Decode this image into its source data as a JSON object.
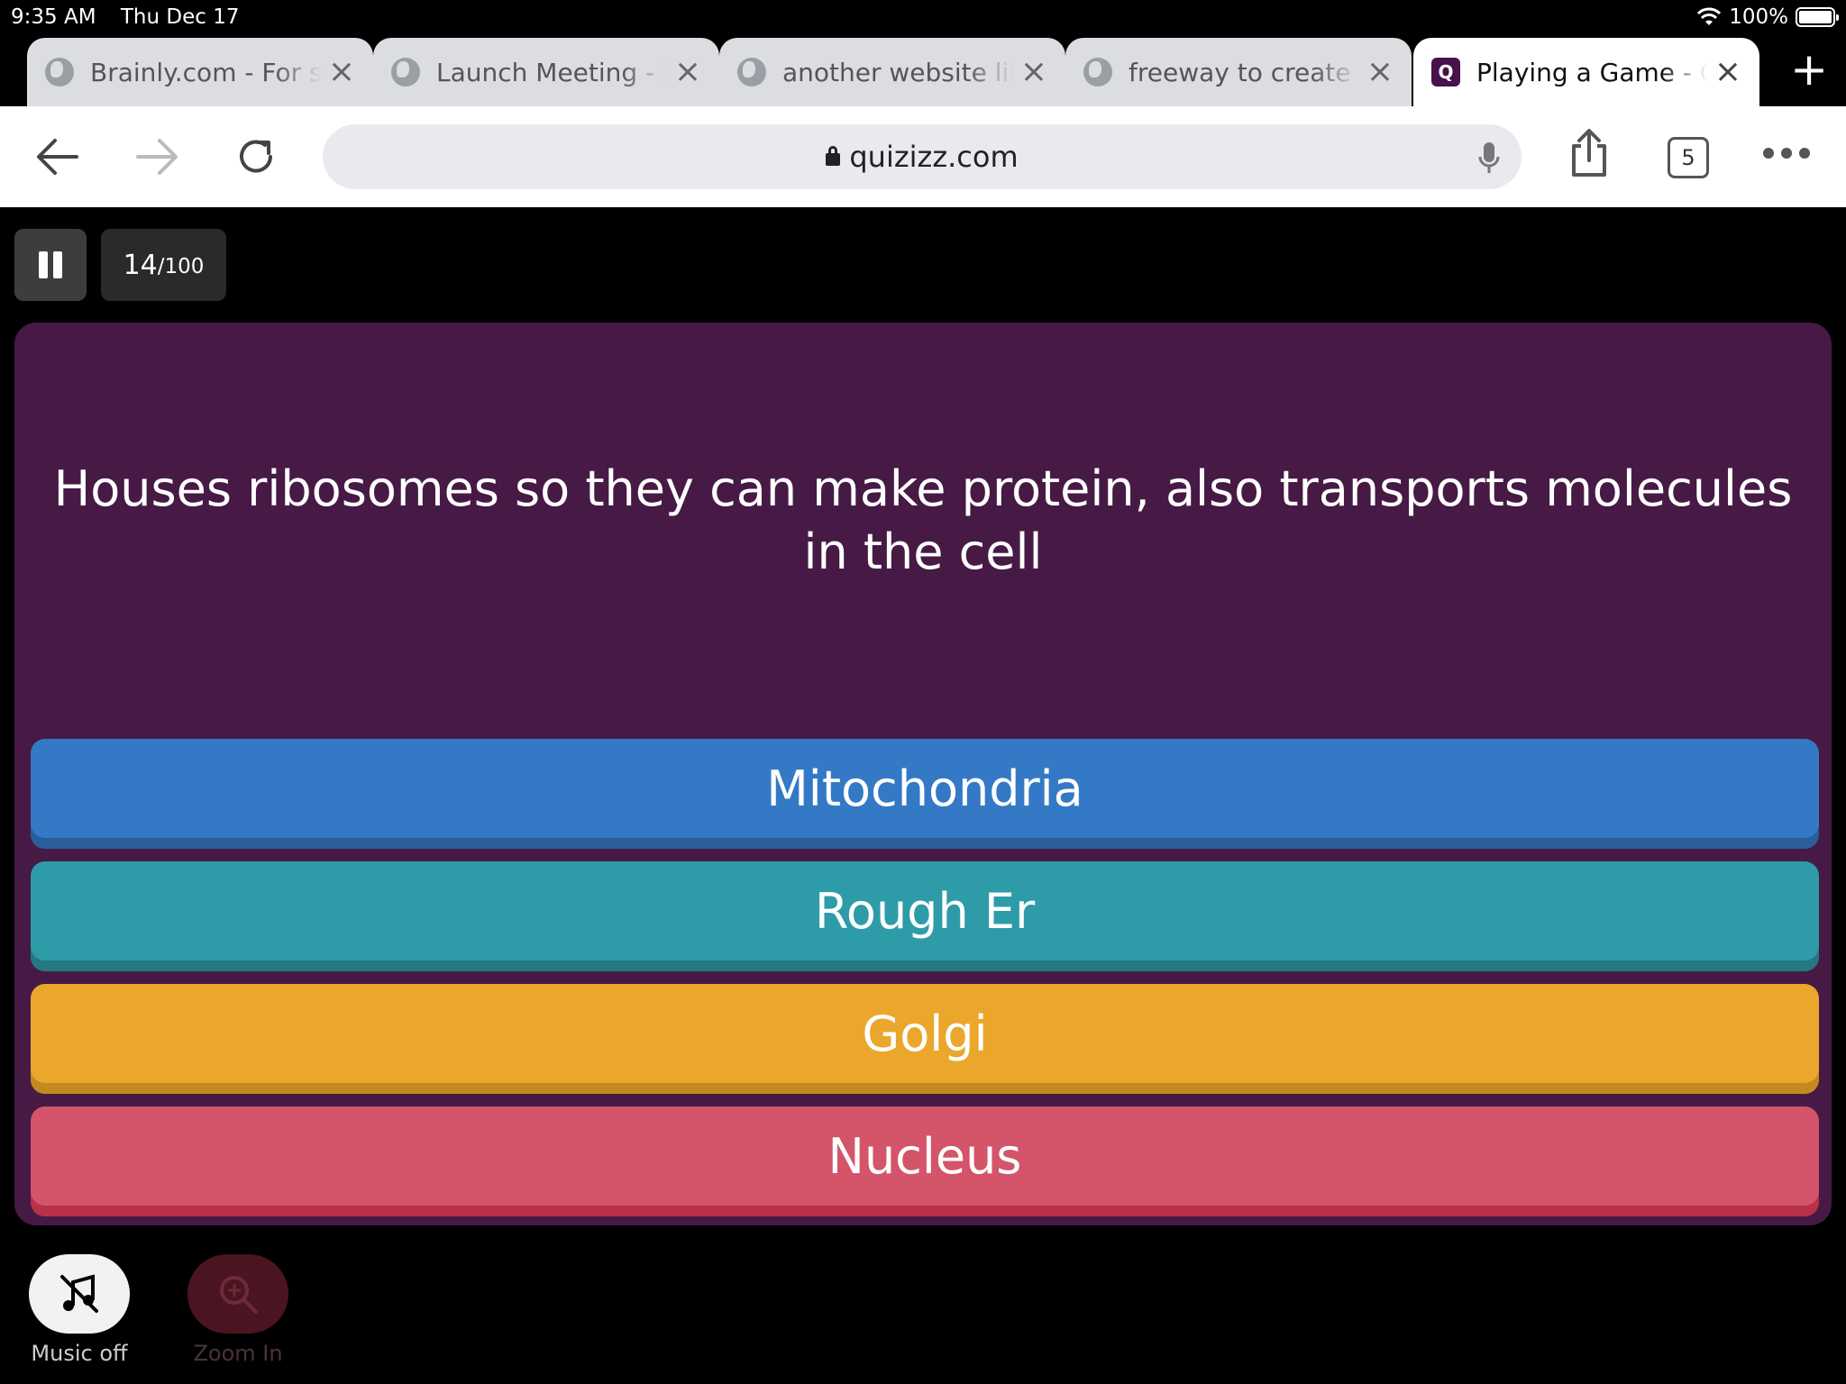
{
  "status": {
    "time": "9:35 AM",
    "date": "Thu Dec 17",
    "battery": "100%"
  },
  "tabs": [
    {
      "title": "Brainly.com - For s"
    },
    {
      "title": "Launch Meeting - Z"
    },
    {
      "title": "another website lik"
    },
    {
      "title": "freeway to create a"
    },
    {
      "title": "Playing a Game - Q",
      "active": true
    }
  ],
  "toolbar": {
    "url": "quizizz.com",
    "tab_count": "5"
  },
  "game": {
    "current": "14",
    "total": "/100",
    "question": "Houses ribosomes so they can make protein, also transports molecules in the cell",
    "options": [
      "Mitochondria",
      "Rough Er",
      "Golgi",
      "Nucleus"
    ]
  },
  "bottom": {
    "music_label": "Music off",
    "zoom_label": "Zoom In"
  },
  "colors": {
    "panel": "#461a45",
    "option1": "#3479c6",
    "option2": "#2d9ca8",
    "option3": "#eba72c",
    "option4": "#d4546a"
  },
  "icons": [
    "wifi-icon",
    "battery-icon",
    "globe-icon",
    "close-icon",
    "plus-icon",
    "back-arrow-icon",
    "forward-arrow-icon",
    "reload-icon",
    "lock-icon",
    "microphone-icon",
    "share-icon",
    "tabs-icon",
    "more-icon",
    "pause-icon",
    "music-off-icon",
    "zoom-in-icon"
  ]
}
